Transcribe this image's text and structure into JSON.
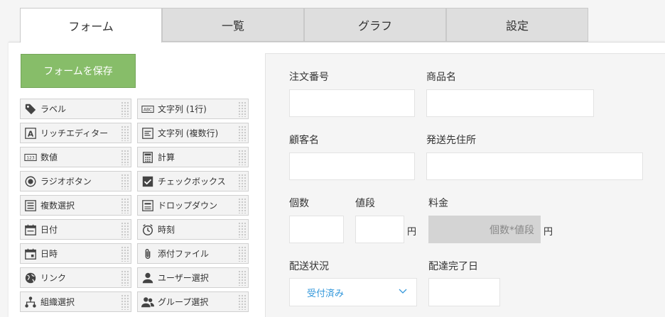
{
  "tabs": [
    {
      "label": "フォーム",
      "active": true
    },
    {
      "label": "一覧",
      "active": false
    },
    {
      "label": "グラフ",
      "active": false
    },
    {
      "label": "設定",
      "active": false
    }
  ],
  "save_button": {
    "label": "フォームを保存"
  },
  "palette": [
    {
      "label": "ラベル",
      "icon": "tag-icon"
    },
    {
      "label": "文字列 (1行)",
      "icon": "abc-icon"
    },
    {
      "label": "リッチエディター",
      "icon": "rich-editor-icon"
    },
    {
      "label": "文字列 (複数行)",
      "icon": "multiline-text-icon"
    },
    {
      "label": "数値",
      "icon": "number-icon"
    },
    {
      "label": "計算",
      "icon": "calculator-icon"
    },
    {
      "label": "ラジオボタン",
      "icon": "radio-icon"
    },
    {
      "label": "チェックボックス",
      "icon": "checkbox-icon"
    },
    {
      "label": "複数選択",
      "icon": "multi-select-icon"
    },
    {
      "label": "ドロップダウン",
      "icon": "dropdown-icon"
    },
    {
      "label": "日付",
      "icon": "date-icon"
    },
    {
      "label": "時刻",
      "icon": "clock-icon"
    },
    {
      "label": "日時",
      "icon": "datetime-icon"
    },
    {
      "label": "添付ファイル",
      "icon": "paperclip-icon"
    },
    {
      "label": "リンク",
      "icon": "globe-icon"
    },
    {
      "label": "ユーザー選択",
      "icon": "user-icon"
    },
    {
      "label": "組織選択",
      "icon": "org-icon"
    },
    {
      "label": "グループ選択",
      "icon": "group-icon"
    }
  ],
  "form": {
    "order_number": {
      "label": "注文番号",
      "value": ""
    },
    "product_name": {
      "label": "商品名",
      "value": ""
    },
    "customer_name": {
      "label": "顧客名",
      "value": ""
    },
    "ship_address": {
      "label": "発送先住所",
      "value": ""
    },
    "quantity": {
      "label": "個数",
      "value": ""
    },
    "price": {
      "label": "値段",
      "value": "",
      "unit": "円"
    },
    "fee": {
      "label": "料金",
      "formula": "個数*値段",
      "unit": "円"
    },
    "delivery_status": {
      "label": "配送状況",
      "selected": "受付済み"
    },
    "delivery_done_date": {
      "label": "配達完了日",
      "value": ""
    }
  },
  "colors": {
    "save_button": "#87bd69",
    "dropdown_text": "#3498db",
    "tab_inactive": "#dedede"
  }
}
